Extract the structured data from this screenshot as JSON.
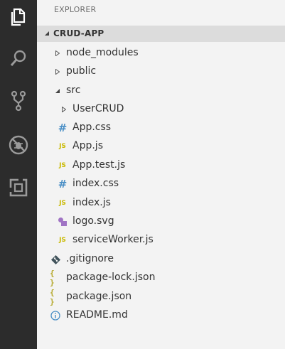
{
  "activity_bar": {
    "items": [
      {
        "icon": "files-icon"
      },
      {
        "icon": "search-icon"
      },
      {
        "icon": "source-control-icon"
      },
      {
        "icon": "debug-icon"
      },
      {
        "icon": "extensions-icon"
      }
    ]
  },
  "explorer": {
    "title": "EXPLORER",
    "project": {
      "name": "CRUD-APP",
      "expanded": true
    },
    "items": [
      {
        "name": "node_modules",
        "type": "folder",
        "expanded": false
      },
      {
        "name": "public",
        "type": "folder",
        "expanded": false
      },
      {
        "name": "src",
        "type": "folder",
        "expanded": true
      },
      {
        "name": "UserCRUD",
        "type": "folder",
        "expanded": false
      },
      {
        "name": "App.css",
        "type": "css"
      },
      {
        "name": "App.js",
        "type": "js"
      },
      {
        "name": "App.test.js",
        "type": "js"
      },
      {
        "name": "index.css",
        "type": "css"
      },
      {
        "name": "index.js",
        "type": "js"
      },
      {
        "name": "logo.svg",
        "type": "svg"
      },
      {
        "name": "serviceWorker.js",
        "type": "js"
      },
      {
        "name": ".gitignore",
        "type": "git"
      },
      {
        "name": "package-lock.json",
        "type": "json"
      },
      {
        "name": "package.json",
        "type": "json"
      },
      {
        "name": "README.md",
        "type": "info"
      }
    ]
  },
  "icon_labels": {
    "js": "JS",
    "css": "#",
    "json": "{ }"
  },
  "colors": {
    "activity_bar": "#2c2c2c",
    "sidebar": "#f3f3f3",
    "section_header": "#dcdcdc",
    "js": "#c9b900",
    "css": "#4a8fc6",
    "json": "#b5a82b",
    "svg": "#a074c4"
  }
}
